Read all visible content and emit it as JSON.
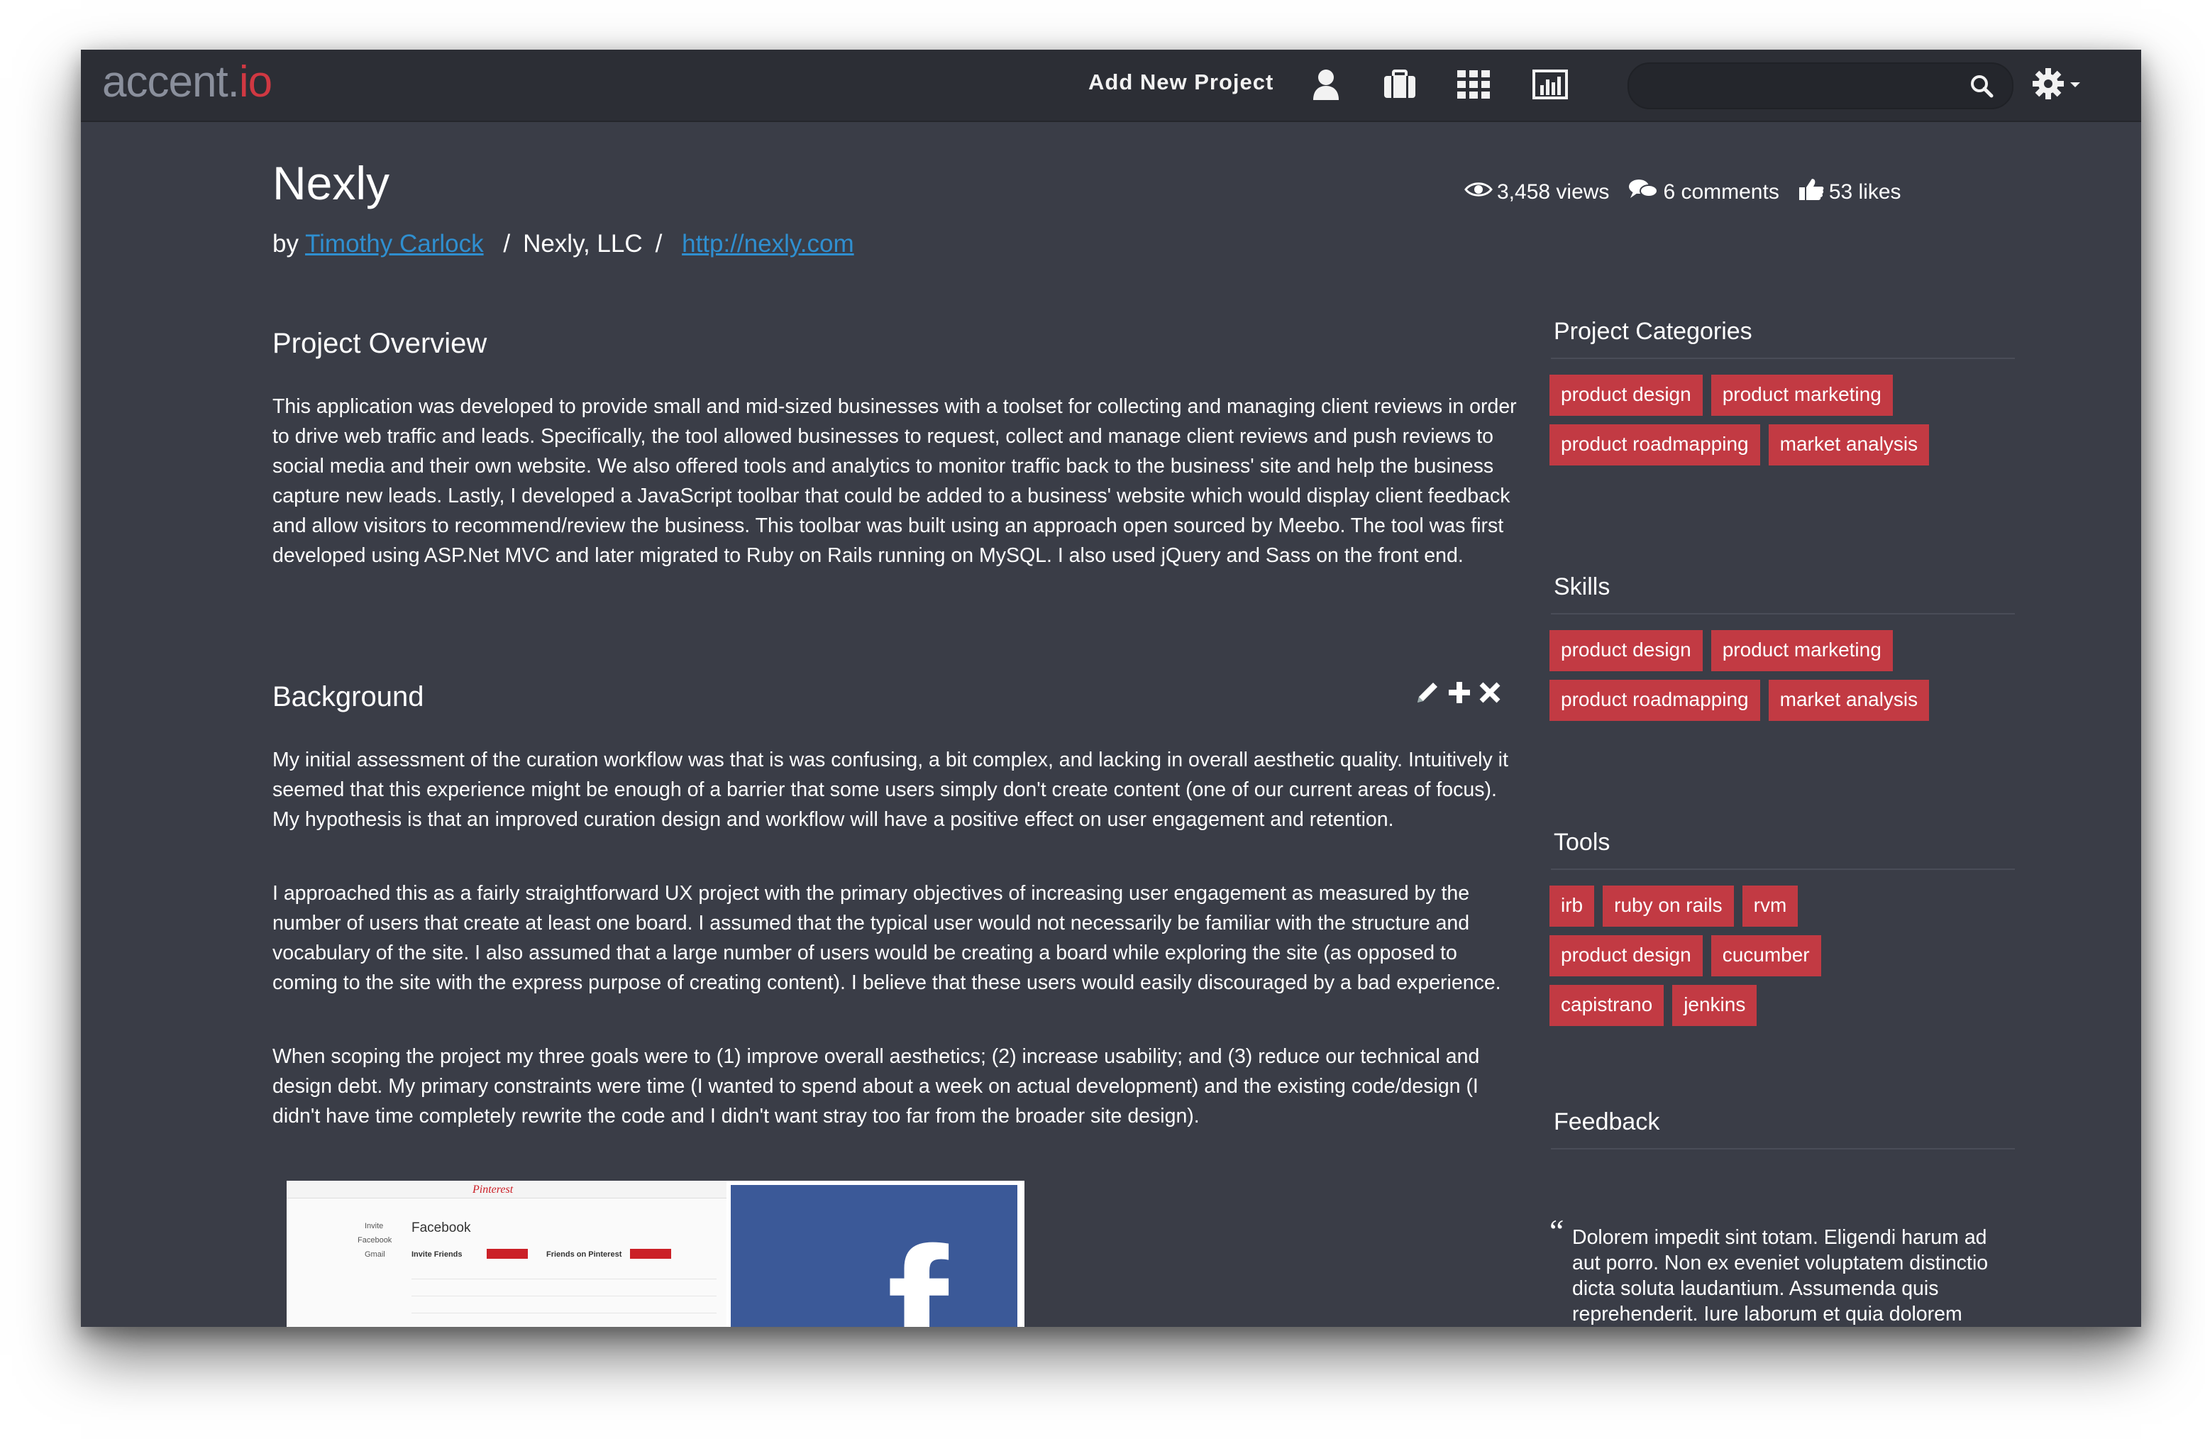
{
  "app": {
    "logo_main": "accent.",
    "logo_suffix": "io"
  },
  "nav": {
    "add_project_label": "Add New Project",
    "icons": [
      "user-icon",
      "briefcase-icon",
      "grid-icon",
      "chart-icon"
    ],
    "search_placeholder": "",
    "settings_icon": "gear-icon"
  },
  "project": {
    "title": "Nexly",
    "by_prefix": "by",
    "author": "Timothy Carlock",
    "company": "Nexly, LLC",
    "url": "http://nexly.com",
    "stats": {
      "views": "3,458 views",
      "comments": "6 comments",
      "likes": "53 likes"
    }
  },
  "overview": {
    "title": "Project Overview",
    "text": "This application was developed to provide small and mid-sized businesses with a toolset for collecting and managing client reviews in order to drive web traffic and leads. Specifically, the tool allowed businesses to request, collect and manage client reviews and push reviews to social media and their own website. We also offered tools and analytics to monitor traffic back to the business' site and help the business capture new leads. Lastly, I developed a JavaScript toolbar that could be added to a business' website which would display client feedback and allow visitors to recommend/review the business. This toolbar was built using an approach open sourced by Meebo. The tool was first developed using ASP.Net MVC and later migrated to Ruby on Rails running on MySQL. I also used jQuery and Sass on the front end."
  },
  "background": {
    "title": "Background",
    "paragraphs": [
      "My initial assessment of the curation workflow was that is was confusing, a bit complex, and lacking in overall aesthetic quality. Intuitively it seemed that this experience might be enough of a barrier that some users simply don't create content (one of our current areas of focus). My hypothesis is that an improved curation design and workflow will have a positive effect on user engagement and retention.",
      "I approached this as a fairly straightforward UX project with the primary objectives of increasing user engagement as measured by the number of users that create at least one board. I assumed that the typical user would not necessarily be familiar with the structure and vocabulary of the site. I also assumed that a large number of users would be creating a board while exploring the site (as opposed to coming to the site with the express purpose of creating content). I believe that these users would easily discouraged by a bad experience.",
      "When scoping the project my three goals were to (1) improve overall aesthetics; (2) increase usability; and (3) reduce our technical and design debt. My primary constraints were time (I wanted to spend about a week on actual development) and the existing code/design (I didn't have time completely rewrite the code and I didn't want stray too far from the broader site design)."
    ]
  },
  "screenshot": {
    "logo": "Pinterest",
    "heading": "Facebook",
    "invite_friends": "Invite Friends",
    "friends_on": "Friends on Pinterest",
    "left_menu": [
      "Invite",
      "Facebook",
      "Gmail"
    ]
  },
  "sidebar": {
    "categories": {
      "title": "Project Categories",
      "tags": [
        "product design",
        "product marketing",
        "product roadmapping",
        "market analysis"
      ]
    },
    "skills": {
      "title": "Skills",
      "tags": [
        "product design",
        "product marketing",
        "product roadmapping",
        "market analysis"
      ]
    },
    "tools": {
      "title": "Tools",
      "tags": [
        "irb",
        "ruby on rails",
        "rvm",
        "product design",
        "cucumber",
        "capistrano",
        "jenkins"
      ]
    },
    "feedback": {
      "title": "Feedback",
      "text": "Dolorem impedit sint totam. Eligendi harum ad aut porro. Non ex eveniet voluptatem distinctio dicta soluta laudantium. Assumenda quis reprehenderit. Iure laborum et quia dolorem sint explicabo"
    }
  },
  "colors": {
    "background": "#3a3d47",
    "topbar": "#2c2e35",
    "tag": "#c23a43",
    "link": "#2f8fd0",
    "logo_io": "#d03842"
  }
}
